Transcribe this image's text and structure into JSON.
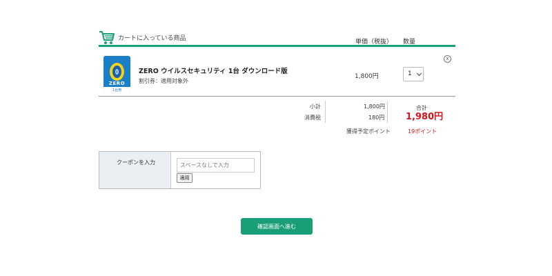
{
  "cart": {
    "title": "カートに入っている商品",
    "col_price": "単価（税抜）",
    "col_qty": "数量"
  },
  "item": {
    "thumb_text": "ZERO",
    "thumb_sub": "1台用",
    "name": "ZERO ウイルスセキュリティ 1台 ダウンロード版",
    "coupon_note": "割引券：適用対象外",
    "price": "1,800円",
    "qty": "1",
    "remove_label": "x"
  },
  "summary": {
    "subtotal_label": "小計",
    "subtotal_value": "1,800円",
    "tax_label": "消費税",
    "tax_value": "180円",
    "points_label": "獲得予定ポイント",
    "points_value": "19ポイント",
    "total_label": "合計",
    "total_value": "1,980円"
  },
  "coupon": {
    "label": "クーポンを入力",
    "placeholder": "スペースなしで入力",
    "apply_label": "適用"
  },
  "actions": {
    "confirm_label": "確認画面へ進む"
  },
  "colors": {
    "accent": "#1a9e78",
    "price_red": "#d4141d"
  },
  "icons": {
    "cart": "shopping-cart-icon",
    "remove": "close-circle-icon",
    "chevron": "chevron-down-icon"
  }
}
